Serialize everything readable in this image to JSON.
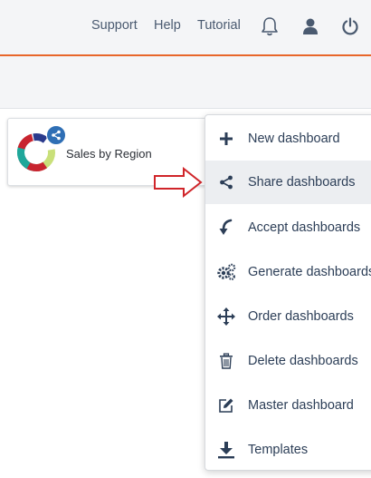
{
  "topbar": {
    "links": {
      "support": "Support",
      "help": "Help",
      "tutorial": "Tutorial"
    },
    "accent_color": "#e8662a"
  },
  "card": {
    "title": "Sales by Region"
  },
  "menu": {
    "items": [
      {
        "label": "New dashboard",
        "icon": "plus-icon"
      },
      {
        "label": "Share dashboards",
        "icon": "share-icon"
      },
      {
        "label": "Accept dashboards",
        "icon": "accept-arrow-icon"
      },
      {
        "label": "Generate dashboards",
        "icon": "gears-icon"
      },
      {
        "label": "Order dashboards",
        "icon": "move-arrows-icon"
      },
      {
        "label": "Delete dashboards",
        "icon": "trash-icon"
      },
      {
        "label": "Master dashboard",
        "icon": "edit-icon"
      },
      {
        "label": "Templates",
        "icon": "download-icon"
      }
    ],
    "highlighted_index": 1
  }
}
